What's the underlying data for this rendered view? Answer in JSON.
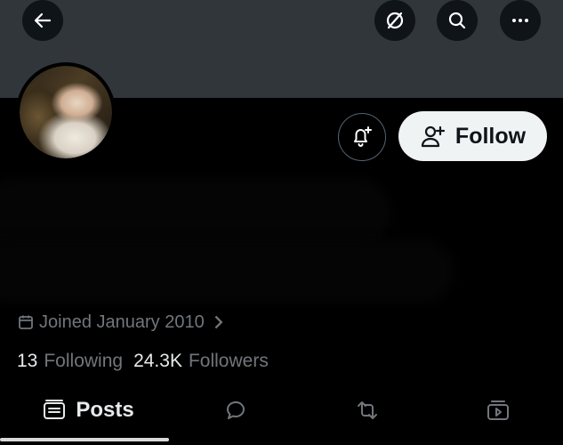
{
  "header": {
    "back_icon": "arrow-left-icon",
    "grok_icon": "grok-icon",
    "search_icon": "search-icon",
    "more_icon": "more-horizontal-icon"
  },
  "profile": {
    "notify_icon": "bell-plus-icon",
    "follow_label": "Follow",
    "follow_icon": "person-plus-icon",
    "joined_text": "Joined January 2010",
    "following_count": "13",
    "following_label": "Following",
    "followers_count": "24.3K",
    "followers_label": "Followers"
  },
  "tabs": [
    {
      "label": "Posts",
      "icon": "posts-icon",
      "active": true
    },
    {
      "label": "",
      "icon": "reply-bubble-icon",
      "active": false
    },
    {
      "label": "",
      "icon": "repost-icon",
      "active": false
    },
    {
      "label": "",
      "icon": "media-play-icon",
      "active": false
    }
  ],
  "colors": {
    "background": "#000000",
    "banner": "#31363b",
    "muted_text": "#71767b",
    "follow_bg": "#eff3f4"
  }
}
